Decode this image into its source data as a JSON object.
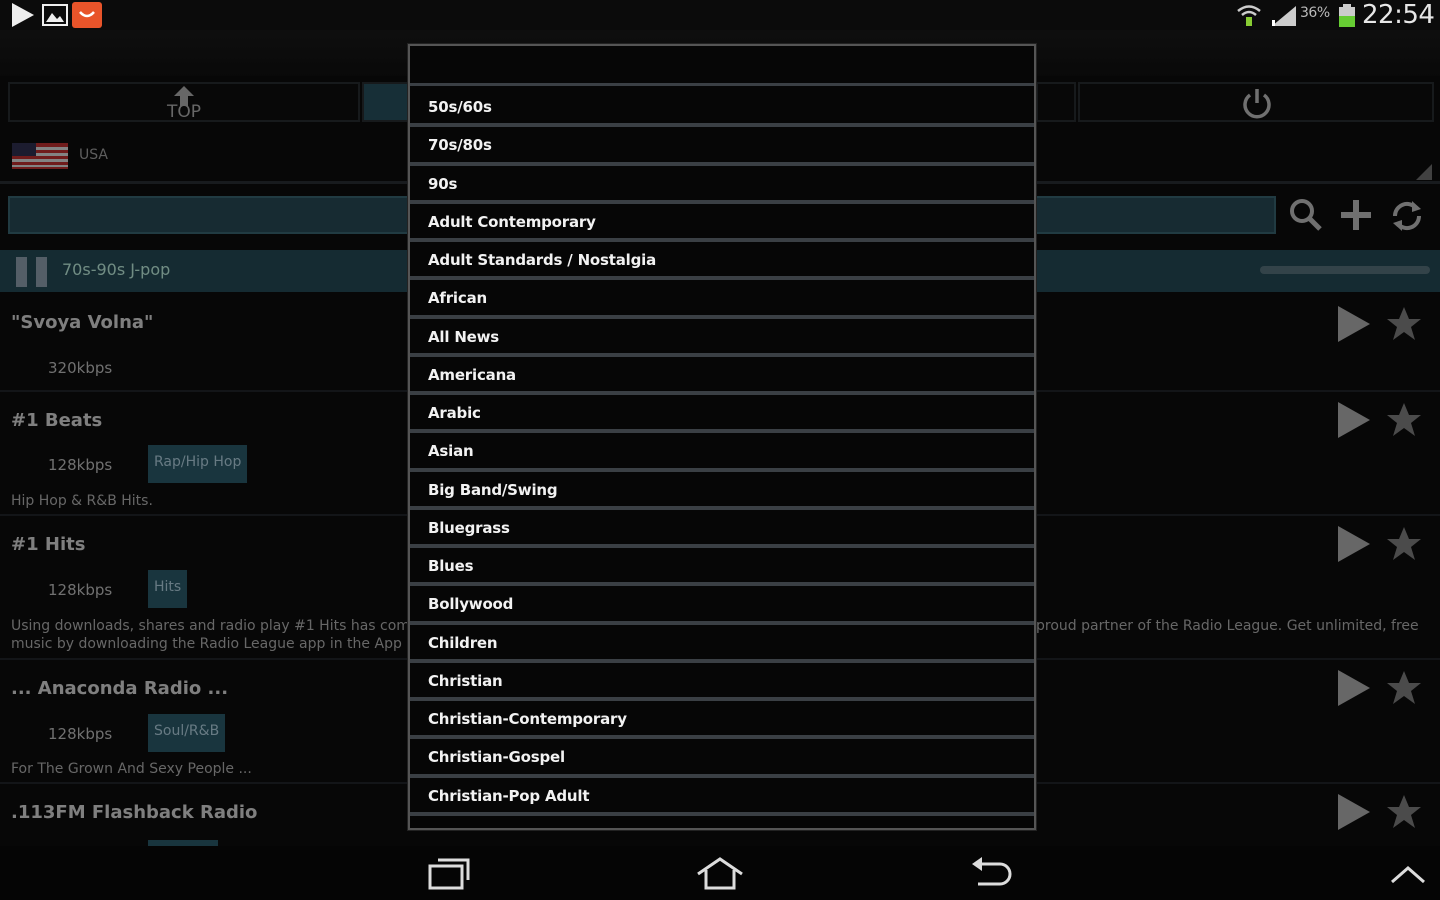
{
  "status_bar": {
    "battery_percent": "36%",
    "time": "22:54",
    "icons": [
      "play-icon",
      "gallery-icon",
      "app-notification-icon",
      "wifi-icon",
      "signal-icon",
      "battery-icon"
    ]
  },
  "tabs": {
    "top_label": "TOP"
  },
  "country": {
    "name": "USA"
  },
  "now_playing": {
    "title": "70s-90s J-pop"
  },
  "stations": [
    {
      "name": "\"Svoya Volna\"",
      "bitrate": "320kbps",
      "genre": "",
      "description": ""
    },
    {
      "name": "#1 Beats",
      "bitrate": "128kbps",
      "genre": "Rap/Hip Hop",
      "description": "Hip Hop & R&B Hits."
    },
    {
      "name": "#1 Hits",
      "bitrate": "128kbps",
      "genre": "Hits",
      "description_left": "Using downloads, shares and radio play #1 Hits has com",
      "description_left2": "music by downloading the Radio League app in the App ;",
      "description_right": "proud partner of the Radio League. Get unlimited, free"
    },
    {
      "name": "... Anaconda Radio ...",
      "bitrate": "128kbps",
      "genre": "Soul/R&B",
      "description": "For The Grown And Sexy People ..."
    },
    {
      "name": ".113FM Flashback Radio",
      "bitrate": "",
      "genre": "",
      "description": ""
    }
  ],
  "genre_dropdown": {
    "items": [
      "50s/60s",
      "70s/80s",
      "90s",
      "Adult Contemporary",
      "Adult Standards / Nostalgia",
      "African",
      "All News",
      "Americana",
      "Arabic",
      "Asian",
      "Big Band/Swing",
      "Bluegrass",
      "Blues",
      "Bollywood",
      "Children",
      "Christian",
      "Christian-Contemporary",
      "Christian-Gospel",
      "Christian-Pop Adult"
    ]
  },
  "colors": {
    "accent": "#2a5564",
    "dropdown_bg": "#060606",
    "divider": "#3a3f44"
  }
}
